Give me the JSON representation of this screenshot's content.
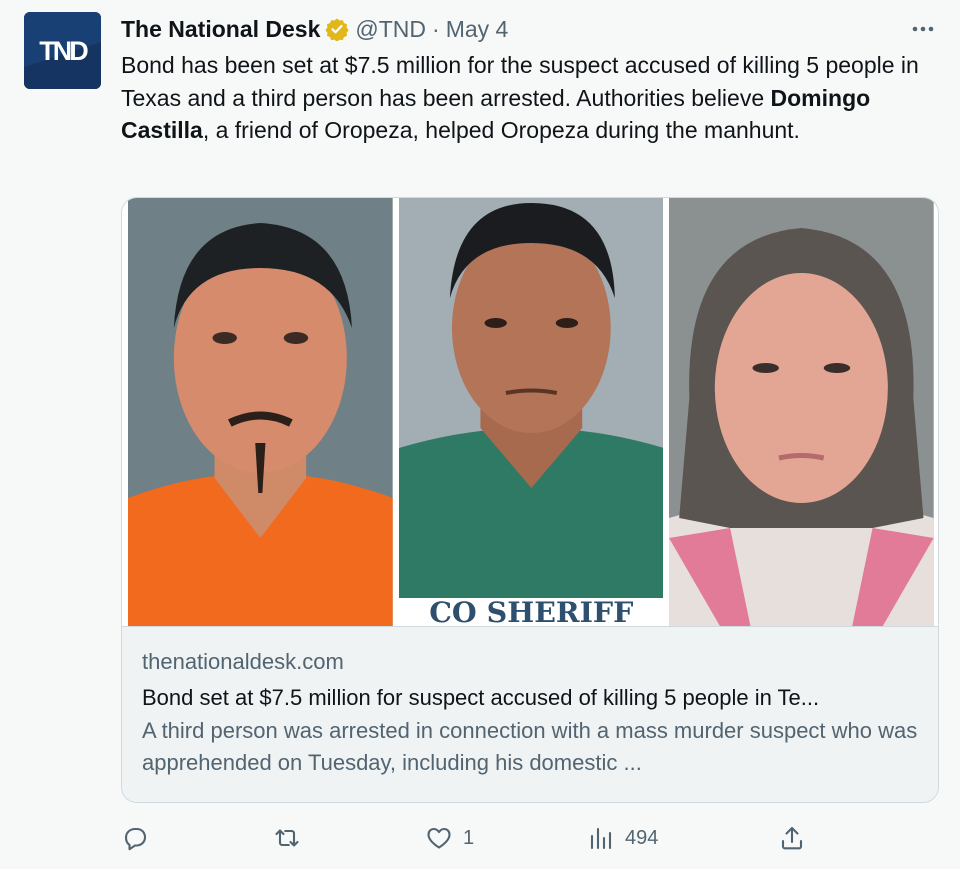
{
  "tweet": {
    "author_name": "The National Desk",
    "handle": "@TND",
    "separator": "·",
    "date": "May 4",
    "avatar_text": "TND",
    "text_part1": "Bond has been set at $7.5 million for the suspect accused of killing 5 people in Texas and a third person has been arrested. Authorities believe ",
    "text_bold": "Domingo Castilla",
    "text_part2": ", a friend of Oropeza, helped Oropeza during the manhunt."
  },
  "card": {
    "photo_overlay_text": "CO SHERIFF",
    "domain": "thenationaldesk.com",
    "title": "Bond set at $7.5 million for suspect accused of killing 5 people in Te...",
    "description": "A third person was arrested in connection with a mass murder suspect who was apprehended on Tuesday, including his domestic ..."
  },
  "actions": {
    "reply_icon": "reply-icon",
    "retweet_icon": "retweet-icon",
    "like_icon": "heart-icon",
    "like_count": "1",
    "views_icon": "analytics-icon",
    "views_count": "494",
    "share_icon": "share-icon"
  },
  "colors": {
    "background": "#f7f9f9",
    "text_primary": "#0f1419",
    "text_secondary": "#536471",
    "border": "#cfd9de",
    "verified_gold": "#e2b719"
  }
}
